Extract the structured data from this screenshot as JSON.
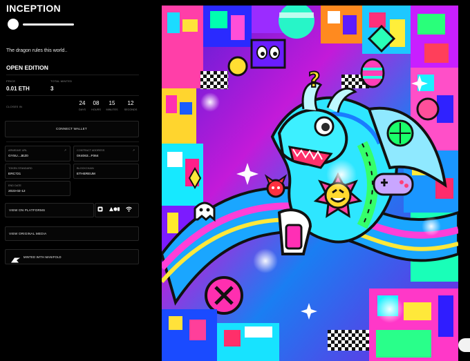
{
  "title": "INCEPTION",
  "description": "The dragon rules this world..",
  "edition": "OPEN EDITION",
  "price": {
    "label": "PRICE",
    "value": "0.01 ETH"
  },
  "total_minted": {
    "label": "TOTAL MINTED",
    "value": "3"
  },
  "countdown": {
    "label": "CLOSES IN",
    "days": "24",
    "days_label": "DAYS",
    "hours": "08",
    "hours_label": "HOURS",
    "minutes": "15",
    "minutes_label": "MINUTES",
    "seconds": "12",
    "seconds_label": "SECONDS"
  },
  "connect_wallet": "CONNECT WALLET",
  "details": {
    "arweave": {
      "label": "ARWEAVE URL",
      "value": "GYSU...JEZ0",
      "corner": "↗"
    },
    "contract": {
      "label": "CONTRACT ADDRESS",
      "value": "0X4063...F064",
      "corner": "↗"
    },
    "standard": {
      "label": "TOKEN STANDARD",
      "value": "ERC721"
    },
    "blockchain": {
      "label": "BLOCKCHAIN",
      "value": "ETHEREUM"
    },
    "end_date": {
      "label": "END DATE",
      "value": "2023-02-12"
    }
  },
  "view_platforms": "VIEW ON PLATFORMS",
  "view_media": "VIEW ORIGINAL MEDIA",
  "minted_with": "MINTED WITH MANIFOLD",
  "icons": {
    "platform_1": "square-platform-icon",
    "platform_2": "dots-platform-icon",
    "platform_3": "wifi-icon",
    "manifold": "manifold-logo-icon"
  },
  "colors": {
    "background": "#000000",
    "text": "#ffffff",
    "muted": "#8a8a8a",
    "border": "#262626"
  }
}
